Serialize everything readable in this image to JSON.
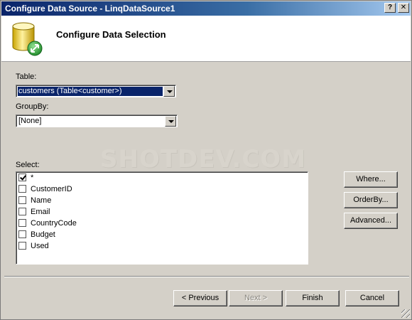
{
  "window": {
    "title": "Configure Data Source - LinqDataSource1",
    "help_label": "?",
    "close_label": "✕"
  },
  "header": {
    "title": "Configure Data Selection",
    "icon": "database-icon"
  },
  "table": {
    "label": "Table:",
    "value": "customers (Table<customer>)"
  },
  "groupby": {
    "label": "GroupBy:",
    "value": "[None]"
  },
  "watermark": "SHOTDEV.COM",
  "select": {
    "label": "Select:",
    "items": [
      {
        "label": "*",
        "checked": true
      },
      {
        "label": "CustomerID",
        "checked": false
      },
      {
        "label": "Name",
        "checked": false
      },
      {
        "label": "Email",
        "checked": false
      },
      {
        "label": "CountryCode",
        "checked": false
      },
      {
        "label": "Budget",
        "checked": false
      },
      {
        "label": "Used",
        "checked": false
      }
    ]
  },
  "side_buttons": {
    "where": "Where...",
    "orderby": "OrderBy...",
    "advanced": "Advanced..."
  },
  "footer_buttons": {
    "previous": "< Previous",
    "next": "Next >",
    "finish": "Finish",
    "cancel": "Cancel"
  },
  "colors": {
    "title_bar": "#0a246a",
    "dialog_bg": "#d4d0c8",
    "selection": "#0a246a"
  }
}
